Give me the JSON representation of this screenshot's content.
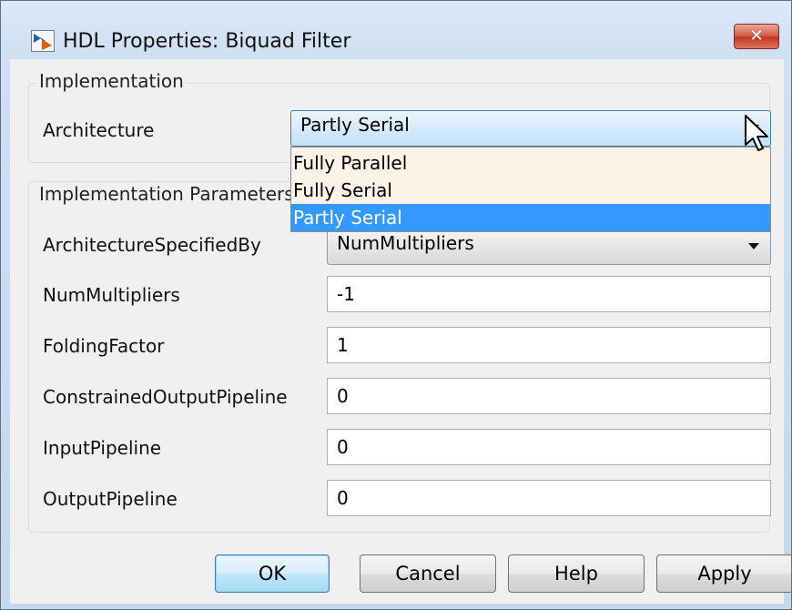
{
  "window": {
    "title": "HDL Properties: Biquad Filter",
    "close_glyph": "✕"
  },
  "implementation": {
    "legend": "Implementation",
    "architecture_label": "Architecture",
    "architecture_value": "Partly Serial",
    "dropdown_options": [
      "Fully Parallel",
      "Fully Serial",
      "Partly Serial"
    ],
    "selected_option": "Partly Serial"
  },
  "parameters": {
    "legend": "Implementation Parameters",
    "architecture_specified_by": {
      "label": "ArchitectureSpecifiedBy",
      "value": "NumMultipliers"
    },
    "num_multipliers": {
      "label": "NumMultipliers",
      "value": "-1"
    },
    "folding_factor": {
      "label": "FoldingFactor",
      "value": "1"
    },
    "constrained_output_pipeline": {
      "label": "ConstrainedOutputPipeline",
      "value": "0"
    },
    "input_pipeline": {
      "label": "InputPipeline",
      "value": "0"
    },
    "output_pipeline": {
      "label": "OutputPipeline",
      "value": "0"
    }
  },
  "buttons": {
    "ok": "OK",
    "cancel": "Cancel",
    "help": "Help",
    "apply": "Apply"
  },
  "icons": {
    "app": "simulink-block-icon",
    "cursor": "mouse-pointer-icon"
  },
  "colors": {
    "selection": "#3399ff",
    "dropdown_bg": "#fcf2e6",
    "close_button": "#c23a22"
  }
}
